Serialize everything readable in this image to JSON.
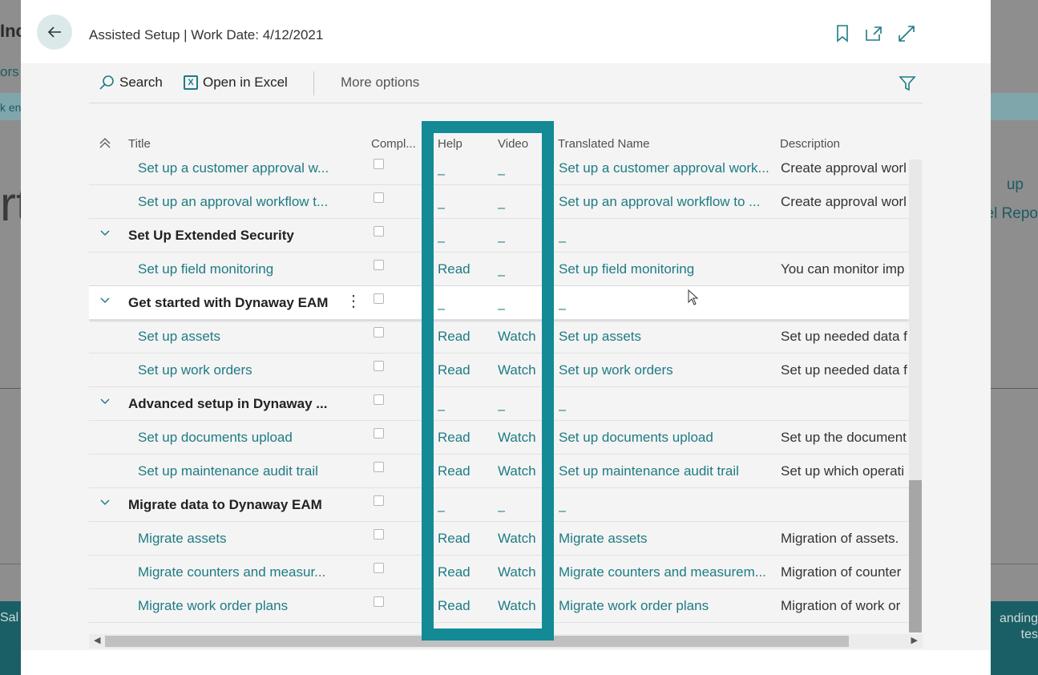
{
  "background": {
    "left_fragments": [
      "Inc",
      "ors",
      "k en"
    ],
    "right_fragments": [
      "up",
      "el Repo"
    ],
    "bottom_left": "Sal",
    "bottom_right": [
      "anding",
      "tes"
    ]
  },
  "header": {
    "title": "Assisted Setup | Work Date: 4/12/2021",
    "back_icon": "arrow-left-icon",
    "icons": [
      "bookmark-icon",
      "open-in-new-window-icon",
      "expand-icon"
    ]
  },
  "actions": {
    "search": "Search",
    "open_excel": "Open in Excel",
    "more": "More options"
  },
  "columns": {
    "title": "Title",
    "completed": "Compl...",
    "help": "Help",
    "video": "Video",
    "translated": "Translated Name",
    "description": "Description"
  },
  "rows": [
    {
      "title": "Set up a customer approval w...",
      "help": "_",
      "video": "_",
      "translated": "Set up a customer approval work...",
      "description": "Create approval worl"
    },
    {
      "title": "Set up an approval workflow t...",
      "help": "_",
      "video": "_",
      "translated": "Set up an approval workflow to ...",
      "description": "Create approval worl"
    },
    {
      "title": "Set Up Extended Security",
      "help": "_",
      "video": "_",
      "translated": "_",
      "description": ""
    },
    {
      "title": "Set up field monitoring",
      "help": "Read",
      "video": "_",
      "translated": "Set up field monitoring",
      "description": "You can monitor imp"
    },
    {
      "title": "Get started with Dynaway EAM",
      "help": "_",
      "video": "_",
      "translated": "_",
      "description": ""
    },
    {
      "title": "Set up assets",
      "help": "Read",
      "video": "Watch",
      "translated": "Set up assets",
      "description": "Set up needed data f"
    },
    {
      "title": "Set up work orders",
      "help": "Read",
      "video": "Watch",
      "translated": "Set up work orders",
      "description": "Set up needed data f"
    },
    {
      "title": "Advanced setup in Dynaway ...",
      "help": "_",
      "video": "_",
      "translated": "_",
      "description": ""
    },
    {
      "title": "Set up documents upload",
      "help": "Read",
      "video": "Watch",
      "translated": "Set up documents upload",
      "description": "Set up the document"
    },
    {
      "title": "Set up maintenance audit trail",
      "help": "Read",
      "video": "Watch",
      "translated": "Set up maintenance audit trail",
      "description": "Set up which operati"
    },
    {
      "title": "Migrate data to Dynaway EAM",
      "help": "_",
      "video": "_",
      "translated": "_",
      "description": ""
    },
    {
      "title": "Migrate assets",
      "help": "Read",
      "video": "Watch",
      "translated": "Migrate assets",
      "description": "Migration of assets."
    },
    {
      "title": "Migrate counters and measur...",
      "help": "Read",
      "video": "Watch",
      "translated": "Migrate counters and measurem...",
      "description": "Migration of counter"
    },
    {
      "title": "Migrate work order plans",
      "help": "Read",
      "video": "Watch",
      "translated": "Migrate work order plans",
      "description": "Migration of work or"
    }
  ],
  "colors": {
    "accent": "#1e7b84",
    "highlight_frame": "#138a96"
  }
}
